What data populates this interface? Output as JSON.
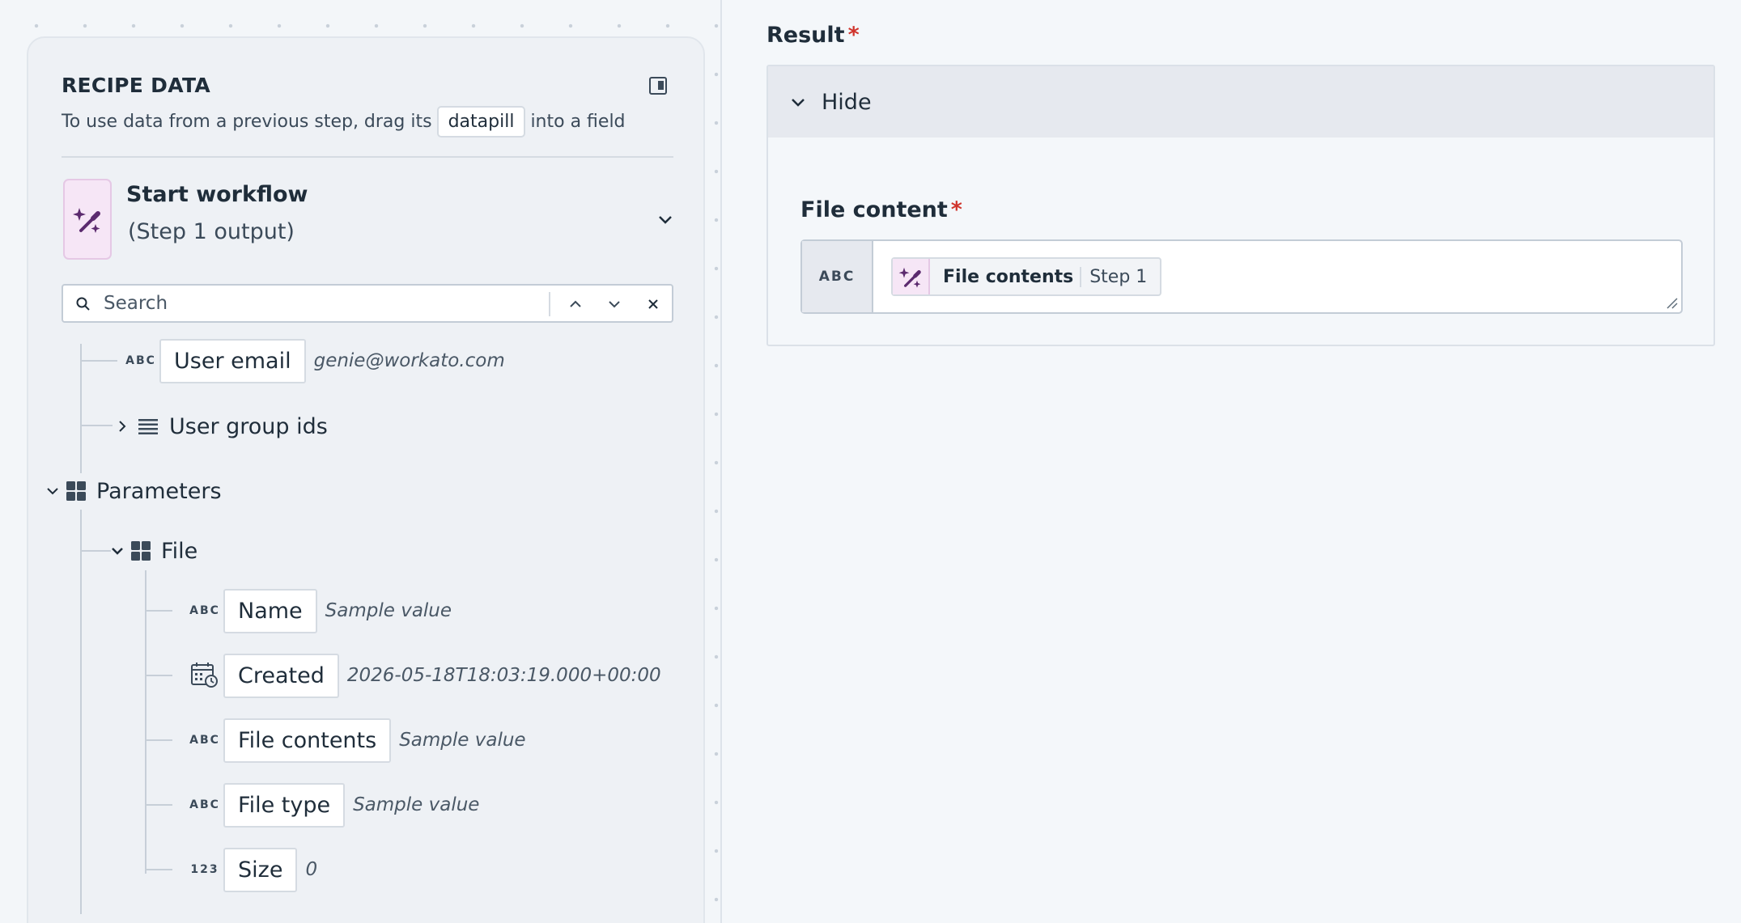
{
  "recipe_panel": {
    "title": "RECIPE DATA",
    "description_before": "To use data from a previous step, drag its",
    "description_pill": "datapill",
    "description_after": "into a field",
    "step": {
      "title": "Start workflow",
      "subtitle": "(Step 1 output)",
      "icon": "magic-wand-icon"
    },
    "search": {
      "placeholder": "Search"
    },
    "tree": {
      "user_email": {
        "type": "ABC",
        "label": "User email",
        "sample": "genie@workato.com"
      },
      "user_group_ids": {
        "label": "User group ids",
        "icon": "list-icon"
      },
      "parameters": {
        "label": "Parameters",
        "icon": "object-icon"
      },
      "file": {
        "label": "File",
        "icon": "object-icon"
      },
      "fields": [
        {
          "type": "ABC",
          "label": "Name",
          "sample": "Sample value"
        },
        {
          "type": "calendar",
          "label": "Created",
          "sample": "2026-05-18T18:03:19.000+00:00"
        },
        {
          "type": "ABC",
          "label": "File contents",
          "sample": "Sample value"
        },
        {
          "type": "ABC",
          "label": "File type",
          "sample": "Sample value"
        },
        {
          "type": "123",
          "label": "Size",
          "sample": "0"
        }
      ]
    }
  },
  "result": {
    "label": "Result",
    "required_mark": "*",
    "hide_label": "Hide",
    "file_content": {
      "label": "File content",
      "required_mark": "*",
      "type": "ABC",
      "pill_name": "File contents",
      "pill_step": "Step 1"
    }
  },
  "colors": {
    "accent_purple": "#5b2a6e",
    "pill_bg": "#f6e6f6",
    "required": "#d0342c"
  }
}
